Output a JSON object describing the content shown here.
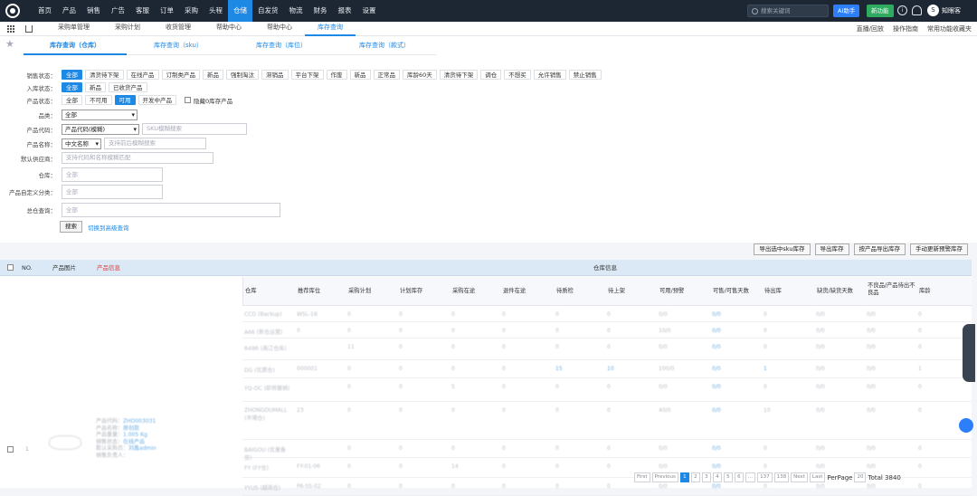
{
  "topnav": {
    "items": [
      "首页",
      "产品",
      "销售",
      "广告",
      "客服",
      "订单",
      "采购",
      "头程",
      "仓储",
      "自发货",
      "物流",
      "财务",
      "报表",
      "设置"
    ],
    "active_index": 8
  },
  "topright": {
    "search_placeholder": "搜索关键词",
    "ai_label": "AI助手",
    "new_label": "新功能",
    "user_initial": "S",
    "user_name": "知眼客"
  },
  "pagetabs": {
    "items": [
      "采购单管理",
      "采购计划",
      "收货管理",
      "帮助中心",
      "帮助中心",
      "库存查询"
    ],
    "active_index": 5
  },
  "tabright": {
    "items": [
      "直播/回放",
      "操作指南",
      "常用功能收藏夹"
    ]
  },
  "subtabs": {
    "items": [
      "库存查询（仓库）",
      "库存查询（sku）",
      "库存查询（库位）",
      "库存查询（款式）"
    ],
    "active_index": 0
  },
  "filters": {
    "sales_label": "销售状态：",
    "sales": [
      "全部",
      "清货待下架",
      "在线产品",
      "订制类产品",
      "新品",
      "强制淘汰",
      "滞销品",
      "平台下架",
      "作废",
      "新品",
      "正常品",
      "库龄60天",
      "清货待下架",
      "调仓",
      "不想买",
      "允许销售",
      "禁止销售"
    ],
    "inbound_label": "入库状态：",
    "inbound": [
      "全部",
      "新品",
      "已收货产品"
    ],
    "product_label": "产品状态：",
    "product": [
      "全部",
      "不可用",
      "可用",
      "开发中产品"
    ],
    "product_active": 2,
    "hide_zero": "隐藏0库存产品",
    "category_label": "品类：",
    "category_value": "全部",
    "code_label": "产品代码：",
    "code_select": "产品代码(模糊)",
    "code_placeholder": "SKU模糊搜索",
    "name_label": "产品名称：",
    "name_select": "中文名称",
    "name_placeholder": "支持前后模糊搜索",
    "supplier_label": "默认供应商：",
    "supplier_placeholder": "支持代码和名称模糊匹配",
    "warehouse_label": "仓库：",
    "warehouse_placeholder": "全部",
    "custom_label": "产品自定义分类：",
    "custom_placeholder": "全部",
    "total_label": "总仓查询：",
    "total_placeholder": "全部",
    "search_btn": "搜索",
    "advanced_link": "切换到高级查询"
  },
  "actions": [
    "导出选中sku库存",
    "导出库存",
    "按产品导出库存",
    "手动更新预警库存"
  ],
  "table": {
    "head": {
      "no": "NO.",
      "image": "产品图片",
      "info": "产品信息",
      "warehouse": "仓库信息"
    },
    "sub": [
      "仓库",
      "推荐库位",
      "采购计划",
      "计划库存",
      "采购在途",
      "退件在途",
      "待质检",
      "待上架",
      "可用/预警",
      "可售/可售天数",
      "待出库",
      "缺货/缺货天数",
      "不良品/产品待出不良品",
      "库龄"
    ],
    "rows": [
      [
        "CCO (Backup)",
        "WSL-16",
        "0",
        "0",
        "0",
        "0",
        "0",
        "0",
        "0/0",
        "0/0",
        "0",
        "0/0",
        "0/0",
        "0"
      ],
      [
        "A66 (新仓运营)",
        "0",
        "0",
        "0",
        "0",
        "0",
        "0",
        "0",
        "10/0",
        "0/0",
        "0",
        "0/0",
        "0/0",
        "0"
      ],
      [
        "R49R (南江仓库)",
        "",
        "11",
        "0",
        "0",
        "0",
        "0",
        "0",
        "0/0",
        "0/0",
        "0",
        "0/0",
        "0/0",
        "0"
      ],
      [
        "DG (优质仓)",
        "000001",
        "0",
        "0",
        "0",
        "0",
        "15",
        "10",
        "100/0",
        "0/0",
        "1",
        "0/0",
        "0/0",
        "1"
      ],
      [
        "YQ-OC (即将撤销)",
        "",
        "0",
        "0",
        "5",
        "0",
        "0",
        "0",
        "0/0",
        "0/0",
        "0",
        "0/0",
        "0/0",
        "0"
      ],
      [
        "ZHONGDUMALL (市場仓)",
        "23",
        "0",
        "0",
        "0",
        "0",
        "0",
        "0",
        "40/0",
        "0/0",
        "10",
        "0/0",
        "0/0",
        "0"
      ],
      [
        "BAIGOU (优量备货)",
        "",
        "0",
        "0",
        "0",
        "0",
        "0",
        "0",
        "0/0",
        "0/0",
        "0",
        "0/0",
        "0/0",
        "0"
      ],
      [
        "FY (FY仓)",
        "FY-01-06",
        "0",
        "0",
        "14",
        "0",
        "0",
        "0",
        "0/0",
        "0/0",
        "0",
        "0/0",
        "0/0",
        "0"
      ],
      [
        "YYUS (越南仓)",
        "PA-SS-02",
        "0",
        "0",
        "0",
        "0",
        "0",
        "0",
        "0/0",
        "0/0",
        "0",
        "0/0",
        "0/0",
        "0"
      ]
    ],
    "left_info": [
      [
        "产品代码：",
        "ZHO003031"
      ],
      [
        "产品名称：",
        "原创款"
      ],
      [
        "产品重量：",
        "1.005 Kg"
      ],
      [
        "销售状态：",
        "在线产品"
      ],
      [
        "默认采购员：",
        "刘鑫admin"
      ],
      [
        "销售负责人：",
        ""
      ]
    ],
    "row_no": "1"
  },
  "pager": {
    "items": [
      "First",
      "Previous",
      "1",
      "2",
      "3",
      "4",
      "5",
      "6",
      "...",
      "137",
      "138",
      "Next",
      "Last"
    ],
    "active_index": 2,
    "per_label": "PerPage",
    "per_value": "20",
    "total": "Total 3840"
  }
}
